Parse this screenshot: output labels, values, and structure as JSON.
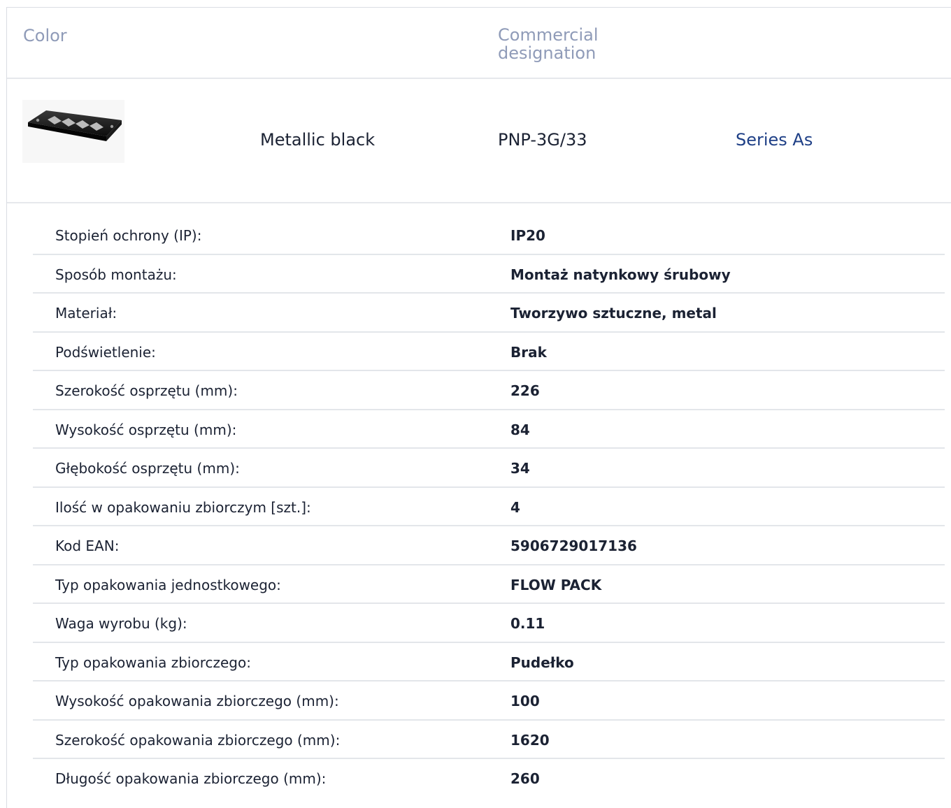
{
  "header": {
    "color_label": "Color",
    "commercial_designation_label": "Commercial designation"
  },
  "product": {
    "image_icon": "product-frame-image",
    "color_value": "Metallic black",
    "designation_value": "PNP-3G/33",
    "series_link": "Series As"
  },
  "specs": [
    {
      "label": "Stopień ochrony (IP):",
      "value": "IP20"
    },
    {
      "label": "Sposób montażu:",
      "value": "Montaż natynkowy śrubowy"
    },
    {
      "label": "Materiał:",
      "value": "Tworzywo sztuczne, metal"
    },
    {
      "label": "Podświetlenie:",
      "value": "Brak"
    },
    {
      "label": "Szerokość osprzętu (mm):",
      "value": "226"
    },
    {
      "label": "Wysokość osprzętu (mm):",
      "value": "84"
    },
    {
      "label": "Głębokość osprzętu (mm):",
      "value": "34"
    },
    {
      "label": "Ilość w opakowaniu zbiorczym [szt.]:",
      "value": "4"
    },
    {
      "label": "Kod EAN:",
      "value": "5906729017136"
    },
    {
      "label": "Typ opakowania jednostkowego:",
      "value": "FLOW PACK"
    },
    {
      "label": "Waga wyrobu (kg):",
      "value": "0.11"
    },
    {
      "label": "Typ opakowania zbiorczego:",
      "value": "Pudełko"
    },
    {
      "label": "Wysokość opakowania zbiorczego (mm):",
      "value": "100"
    },
    {
      "label": "Szerokość opakowania zbiorczego (mm):",
      "value": "1620"
    },
    {
      "label": "Długość opakowania zbiorczego (mm):",
      "value": "260"
    }
  ],
  "colors": {
    "header_text": "#8f9bb8",
    "link": "#1e3f86",
    "body_text": "#1b2233",
    "divider": "#e3e6ea"
  }
}
